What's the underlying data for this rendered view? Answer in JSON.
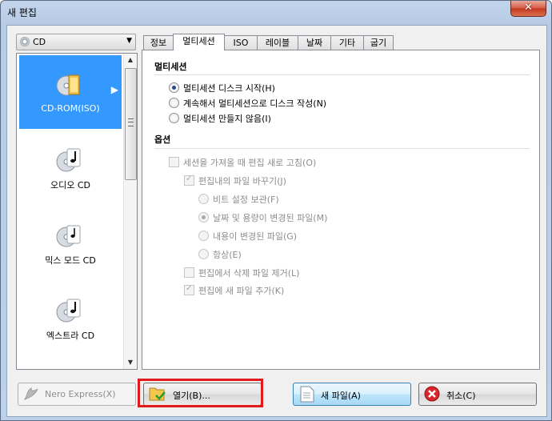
{
  "window": {
    "title": "새 편집",
    "close_label": "✕"
  },
  "media_dropdown": {
    "value": "CD"
  },
  "categories": [
    {
      "label": "CD-ROM(ISO)"
    },
    {
      "label": "오디오 CD"
    },
    {
      "label": "믹스 모드 CD"
    },
    {
      "label": "엑스트라 CD"
    }
  ],
  "tabs": [
    "정보",
    "멀티세션",
    "ISO",
    "레이블",
    "날짜",
    "기타",
    "굽기"
  ],
  "multisession": {
    "title": "멀티세션",
    "options": [
      "멀티세션 디스크 시작(H)",
      "계속해서 멀티세션으로 디스크 작성(N)",
      "멀티세션 만들지 않음(I)"
    ]
  },
  "options": {
    "title": "옵션",
    "reload": "세션을 가져올 때 편집 새로 고침(O)",
    "replace": "편집내의 파일 바꾸기(J)",
    "never": "비트 설정 보관(F)",
    "date_size": "날짜 및 용량이 변경된 파일(M)",
    "content": "내용이 변경된 파일(G)",
    "always": "항상(E)",
    "remove_deleted": "편집에서 삭제 파일 제거(L)",
    "add_new": "편집에 새 파일 추가(K)"
  },
  "buttons": {
    "nero_express": "Nero Express(X)",
    "open": "열기(B)...",
    "new": "새 파일(A)",
    "cancel": "취소(C)"
  }
}
